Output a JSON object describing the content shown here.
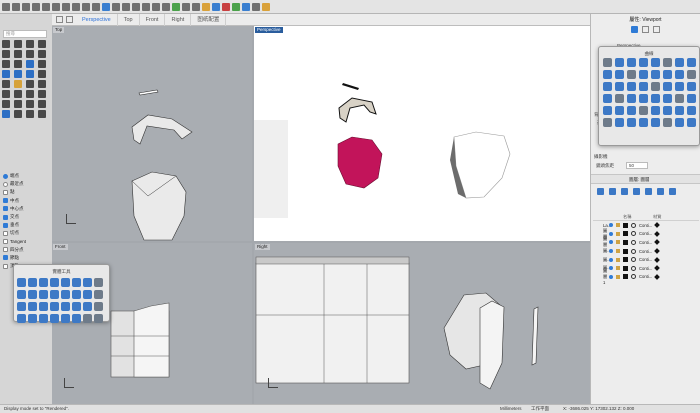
{
  "viewport_tabs": [
    "Perspective",
    "Top",
    "Front",
    "Right",
    "图纸配置"
  ],
  "search_placeholder": "搜尋",
  "views": {
    "top": "Top",
    "perspective": "Perspective",
    "front": "Front",
    "right": "Right"
  },
  "osnap": [
    {
      "label": "端点",
      "checked": true,
      "type": "radio"
    },
    {
      "label": "最近点",
      "checked": false,
      "type": "radio"
    },
    {
      "label": "點",
      "checked": false,
      "type": "check"
    },
    {
      "label": "中点",
      "checked": true,
      "type": "check"
    },
    {
      "label": "中心点",
      "checked": true,
      "type": "check"
    },
    {
      "label": "交点",
      "checked": true,
      "type": "check"
    },
    {
      "label": "垂点",
      "checked": true,
      "type": "check"
    },
    {
      "label": "切点",
      "checked": false,
      "type": "check"
    },
    {
      "label": "Tangent",
      "checked": false,
      "type": "check"
    },
    {
      "label": "四分点",
      "checked": false,
      "type": "check"
    },
    {
      "label": "節點",
      "checked": true,
      "type": "check"
    },
    {
      "label": "頂點",
      "checked": false,
      "type": "check"
    }
  ],
  "popup_left_title": "實體工具",
  "popup_right_title": "曲線",
  "right_panel": {
    "title": "屬性: Viewport",
    "perspective_label": "Perspective",
    "line1": "端點實體",
    "line2": "透視圖樣",
    "bg_label": "背景圖案",
    "bg_select": "選取...",
    "camera_label": "攝影機",
    "lens_label": "鏡頭焦距",
    "lens_value": "50"
  },
  "layers": {
    "header": "圖層: 圖層",
    "col_name": "名稱",
    "col_material": "材質",
    "rows": [
      {
        "name": "La...",
        "line": "Conti..."
      },
      {
        "name": "圖層",
        "line": "Conti..."
      },
      {
        "name": "圖層",
        "line": "Conti..."
      },
      {
        "name": "圖...",
        "line": "Conti..."
      },
      {
        "name": "圖...",
        "line": "Conti..."
      },
      {
        "name": "圖...",
        "line": "Conti..."
      },
      {
        "name": "圖層1",
        "line": "Conti..."
      }
    ]
  },
  "status": {
    "message": "Display mode set to \"Rendered\".",
    "units": "Millimeters",
    "plane": "工作平面",
    "coords": "X: -3686.025   Y: 17302.132   Z: 0.000"
  },
  "colors": {
    "accent": "#2a6fd8",
    "active_view": "#2a5d9d",
    "face_red": "#c2145a"
  }
}
